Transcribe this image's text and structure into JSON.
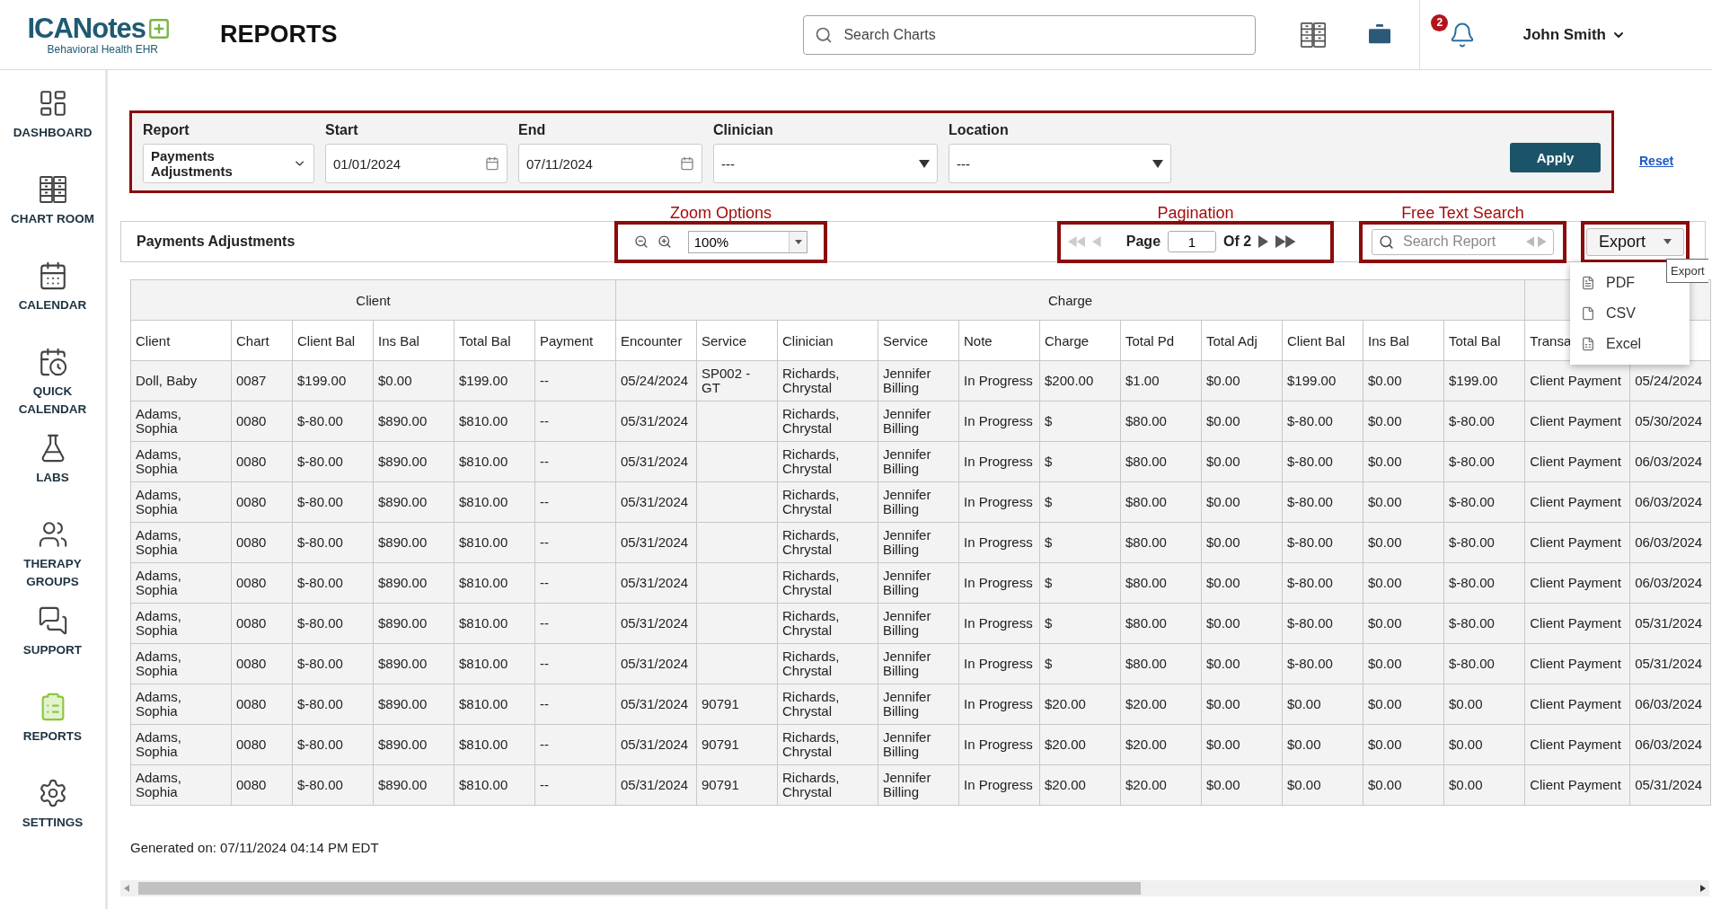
{
  "header": {
    "logo": {
      "name": "ICANotes",
      "tagline": "Behavioral Health EHR"
    },
    "page_title": "REPORTS",
    "search": {
      "placeholder": "Search Charts"
    },
    "notification_count": "2",
    "user": "John Smith"
  },
  "sidebar": {
    "items": [
      {
        "label": "DASHBOARD",
        "kind": "dashboard",
        "selected": false
      },
      {
        "label": "CHART ROOM",
        "kind": "chartroom",
        "selected": false
      },
      {
        "label": "CALENDAR",
        "kind": "calendar",
        "selected": false
      },
      {
        "label": "QUICK CALENDAR",
        "kind": "quickcalendar",
        "selected": false
      },
      {
        "label": "LABS",
        "kind": "labs",
        "selected": false
      },
      {
        "label": "THERAPY GROUPS",
        "kind": "groups",
        "selected": false
      },
      {
        "label": "SUPPORT",
        "kind": "support",
        "selected": false
      },
      {
        "label": "REPORTS",
        "kind": "reports",
        "selected": true
      },
      {
        "label": "SETTINGS",
        "kind": "settings",
        "selected": false
      }
    ]
  },
  "filters": {
    "report": {
      "label": "Report",
      "value": "Payments Adjustments"
    },
    "start": {
      "label": "Start",
      "value": "01/01/2024"
    },
    "end": {
      "label": "End",
      "value": "07/11/2024"
    },
    "clinician": {
      "label": "Clinician",
      "value": "---"
    },
    "location": {
      "label": "Location",
      "value": "---"
    },
    "apply": "Apply",
    "reset": "Reset"
  },
  "annotations": {
    "zoom": "Zoom Options",
    "pagination": "Pagination",
    "search": "Free Text Search"
  },
  "toolbar": {
    "title": "Payments Adjustments",
    "zoom": "100%",
    "pagination": {
      "page_label": "Page",
      "page": "1",
      "of_label": "Of",
      "total": "2"
    },
    "search": {
      "placeholder": "Search Report"
    },
    "export": "Export",
    "tooltip": "Export"
  },
  "export_menu": [
    {
      "label": "PDF",
      "kind": "pdf"
    },
    {
      "label": "CSV",
      "kind": "csv"
    },
    {
      "label": "Excel",
      "kind": "excel"
    }
  ],
  "table": {
    "groups": [
      {
        "label": "Client",
        "columns": [
          "Client",
          "Chart",
          "Client Bal",
          "Ins Bal",
          "Total Bal",
          "Payment"
        ]
      },
      {
        "label": "Charge",
        "columns": [
          "Encounter",
          "Service",
          "Clinician",
          "Service",
          "Note",
          "Charge",
          "Total Pd",
          "Total Adj",
          "Client Bal",
          "Ins Bal",
          "Total Bal"
        ]
      },
      {
        "columns": [
          "Transa",
          null
        ]
      }
    ],
    "rows": [
      [
        "Doll, Baby",
        "0087",
        "$199.00",
        "$0.00",
        "$199.00",
        "--",
        "05/24/2024",
        "SP002 - GT",
        "Richards, Chrystal",
        "Jennifer Billing",
        "In Progress",
        "$200.00",
        "$1.00",
        "$0.00",
        "$199.00",
        "$0.00",
        "$199.00",
        "Client Payment",
        "05/24/2024"
      ],
      [
        "Adams, Sophia",
        "0080",
        "$-80.00",
        "$890.00",
        "$810.00",
        "--",
        "05/31/2024",
        null,
        "Richards, Chrystal",
        "Jennifer Billing",
        "In Progress",
        "$",
        "$80.00",
        "$0.00",
        "$-80.00",
        "$0.00",
        "$-80.00",
        "Client Payment",
        "05/30/2024"
      ],
      [
        "Adams, Sophia",
        "0080",
        "$-80.00",
        "$890.00",
        "$810.00",
        "--",
        "05/31/2024",
        null,
        "Richards, Chrystal",
        "Jennifer Billing",
        "In Progress",
        "$",
        "$80.00",
        "$0.00",
        "$-80.00",
        "$0.00",
        "$-80.00",
        "Client Payment",
        "06/03/2024"
      ],
      [
        "Adams, Sophia",
        "0080",
        "$-80.00",
        "$890.00",
        "$810.00",
        "--",
        "05/31/2024",
        null,
        "Richards, Chrystal",
        "Jennifer Billing",
        "In Progress",
        "$",
        "$80.00",
        "$0.00",
        "$-80.00",
        "$0.00",
        "$-80.00",
        "Client Payment",
        "06/03/2024"
      ],
      [
        "Adams, Sophia",
        "0080",
        "$-80.00",
        "$890.00",
        "$810.00",
        "--",
        "05/31/2024",
        null,
        "Richards, Chrystal",
        "Jennifer Billing",
        "In Progress",
        "$",
        "$80.00",
        "$0.00",
        "$-80.00",
        "$0.00",
        "$-80.00",
        "Client Payment",
        "06/03/2024"
      ],
      [
        "Adams, Sophia",
        "0080",
        "$-80.00",
        "$890.00",
        "$810.00",
        "--",
        "05/31/2024",
        null,
        "Richards, Chrystal",
        "Jennifer Billing",
        "In Progress",
        "$",
        "$80.00",
        "$0.00",
        "$-80.00",
        "$0.00",
        "$-80.00",
        "Client Payment",
        "06/03/2024"
      ],
      [
        "Adams, Sophia",
        "0080",
        "$-80.00",
        "$890.00",
        "$810.00",
        "--",
        "05/31/2024",
        null,
        "Richards, Chrystal",
        "Jennifer Billing",
        "In Progress",
        "$",
        "$80.00",
        "$0.00",
        "$-80.00",
        "$0.00",
        "$-80.00",
        "Client Payment",
        "05/31/2024"
      ],
      [
        "Adams, Sophia",
        "0080",
        "$-80.00",
        "$890.00",
        "$810.00",
        "--",
        "05/31/2024",
        null,
        "Richards, Chrystal",
        "Jennifer Billing",
        "In Progress",
        "$",
        "$80.00",
        "$0.00",
        "$-80.00",
        "$0.00",
        "$-80.00",
        "Client Payment",
        "05/31/2024"
      ],
      [
        "Adams, Sophia",
        "0080",
        "$-80.00",
        "$890.00",
        "$810.00",
        "--",
        "05/31/2024",
        "90791",
        "Richards, Chrystal",
        "Jennifer Billing",
        "In Progress",
        "$20.00",
        "$20.00",
        "$0.00",
        "$0.00",
        "$0.00",
        "$0.00",
        "Client Payment",
        "06/03/2024"
      ],
      [
        "Adams, Sophia",
        "0080",
        "$-80.00",
        "$890.00",
        "$810.00",
        "--",
        "05/31/2024",
        "90791",
        "Richards, Chrystal",
        "Jennifer Billing",
        "In Progress",
        "$20.00",
        "$20.00",
        "$0.00",
        "$0.00",
        "$0.00",
        "$0.00",
        "Client Payment",
        "06/03/2024"
      ],
      [
        "Adams, Sophia",
        "0080",
        "$-80.00",
        "$890.00",
        "$810.00",
        "--",
        "05/31/2024",
        "90791",
        "Richards, Chrystal",
        "Jennifer Billing",
        "In Progress",
        "$20.00",
        "$20.00",
        "$0.00",
        "$0.00",
        "$0.00",
        "$0.00",
        "Client Payment",
        "05/31/2024"
      ]
    ]
  },
  "generated": "Generated on: 07/11/2024 04:14 PM EDT"
}
